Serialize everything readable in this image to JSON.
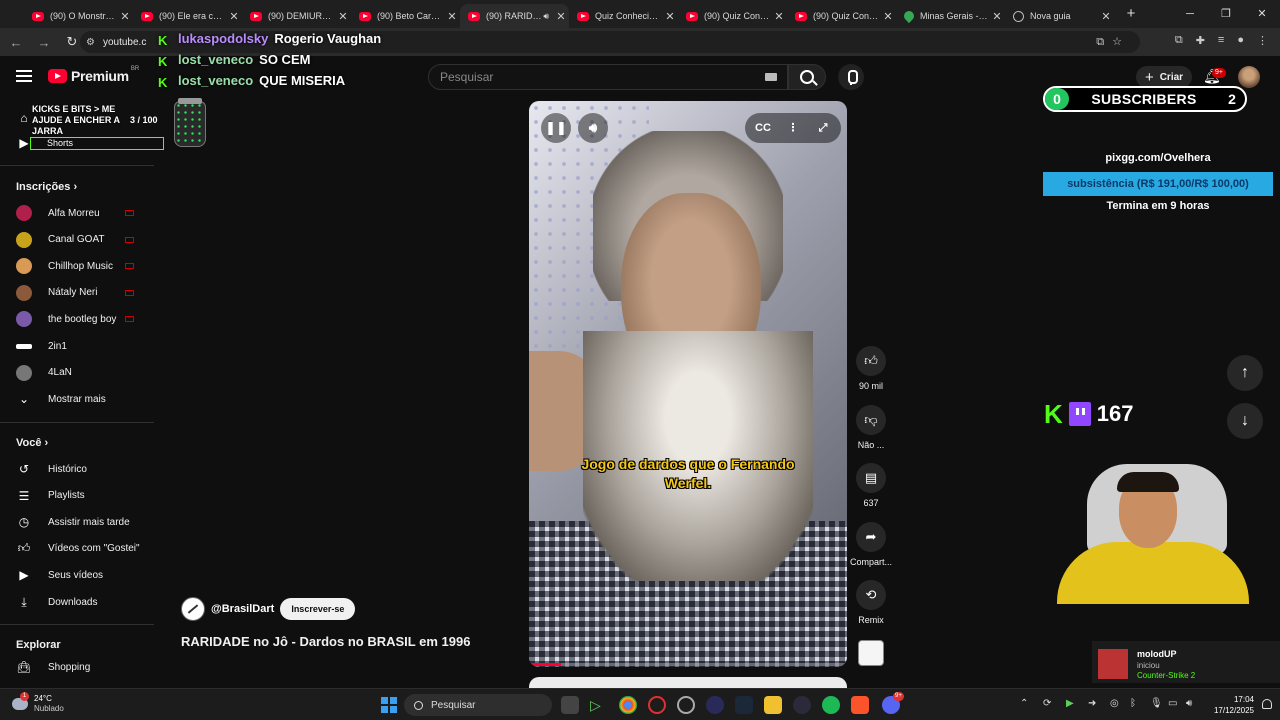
{
  "browser": {
    "tabs": [
      {
        "title": "(90) O Monstro N",
        "favicon": "youtube-icon"
      },
      {
        "title": "(90) Ele era coun",
        "favicon": "youtube-icon"
      },
      {
        "title": "(90) DEMIURGO:",
        "favicon": "youtube-icon"
      },
      {
        "title": "(90) Beto Carvalh",
        "favicon": "youtube-icon"
      },
      {
        "title": "(90) RARIDAD",
        "favicon": "youtube-icon",
        "audio": true,
        "active": true
      },
      {
        "title": "Quiz Conhecimen",
        "favicon": "youtube-icon"
      },
      {
        "title": "(90) Quiz Conhec",
        "favicon": "youtube-icon"
      },
      {
        "title": "(90) Quiz Conhec",
        "favicon": "youtube-icon"
      },
      {
        "title": "Minas Gerais - Go",
        "favicon": "maps-icon"
      },
      {
        "title": "Nova guia",
        "favicon": "globe-icon"
      }
    ],
    "url": "youtube.c"
  },
  "youtube": {
    "logo_text": "Premium",
    "logo_region": "BR",
    "search_placeholder": "Pesquisar",
    "create_label": "Criar",
    "notif_count": "9+"
  },
  "sidebar": {
    "shorts_label": "Shorts",
    "subscriptions_heading": "Inscrições",
    "channels": [
      {
        "name": "Alfa Morreu",
        "live": true,
        "color": "#b0204a"
      },
      {
        "name": "Canal GOAT",
        "live": true,
        "color": "#c8a21a"
      },
      {
        "name": "Chillhop Music",
        "live": true,
        "color": "#d89a55"
      },
      {
        "name": "Nátaly Neri",
        "live": true,
        "color": "#8a5a3a"
      },
      {
        "name": "the bootleg boy",
        "live": true,
        "color": "#7a5aa8"
      },
      {
        "name": "2in1",
        "live": false,
        "color": "#ffffff"
      },
      {
        "name": "4LaN",
        "live": false,
        "color": "#777777"
      }
    ],
    "show_more": "Mostrar mais",
    "you_heading": "Você",
    "you_items": [
      {
        "label": "Histórico",
        "icon": "history-icon"
      },
      {
        "label": "Playlists",
        "icon": "playlist-icon"
      },
      {
        "label": "Assistir mais tarde",
        "icon": "clock-icon"
      },
      {
        "label": "Vídeos com \"Gostei\"",
        "icon": "thumbs-up-icon"
      },
      {
        "label": "Seus vídeos",
        "icon": "video-icon"
      },
      {
        "label": "Downloads",
        "icon": "download-icon"
      }
    ],
    "explore_heading": "Explorar",
    "explore_items": [
      {
        "label": "Shopping",
        "icon": "bag-icon"
      }
    ]
  },
  "overlay": {
    "chat": [
      {
        "user": "lukaspodolsky",
        "message": "Rogerio Vaughan",
        "style": "purple"
      },
      {
        "user": "lost_veneco",
        "message": "SO CEM",
        "style": "blue"
      },
      {
        "user": "lost_veneco",
        "message": "QUE MISERIA",
        "style": "blue"
      }
    ],
    "kicks_goal": "KICKS E BITS > ME AJUDE A ENCHER A JARRA",
    "kicks_count": "3 / 100",
    "subscribers_label": "SUBSCRIBERS",
    "subscribers_left": "0",
    "subscribers_right": "2",
    "pix_url": "pixgg.com/Ovelhera",
    "pix_goal": "subsistência (R$ 191,00/R$ 100,00)",
    "pix_time": "Termina em 9 horas",
    "viewers": "167",
    "notification": {
      "user": "molodUP",
      "status": "iniciou",
      "game": "Counter-Strike 2"
    }
  },
  "short": {
    "subtitle": "Jogo de dardos que o Fernando Werfel.",
    "progress": 0.1,
    "channel_handle": "@BrasilDart",
    "subscribe_label": "Inscrever-se",
    "title": "RARIDADE no Jô - Dardos no BRASIL em 1996",
    "actions": [
      {
        "label": "90 mil",
        "icon": "thumbs-up-icon"
      },
      {
        "label": "Não ...",
        "icon": "thumbs-down-icon"
      },
      {
        "label": "637",
        "icon": "comment-icon"
      },
      {
        "label": "Compart...",
        "icon": "share-icon"
      },
      {
        "label": "Remix",
        "icon": "remix-icon"
      }
    ]
  },
  "taskbar": {
    "weather_temp": "24°C",
    "weather_desc": "Nublado",
    "search_label": "Pesquisar",
    "time": "17:04",
    "date": "17/12/2025",
    "discord_badge": "9+"
  },
  "colors": {
    "youtube_red": "#ff0033",
    "kick_green": "#53fc18",
    "twitch_purple": "#9146ff",
    "pix_blue": "#29a9e1"
  }
}
